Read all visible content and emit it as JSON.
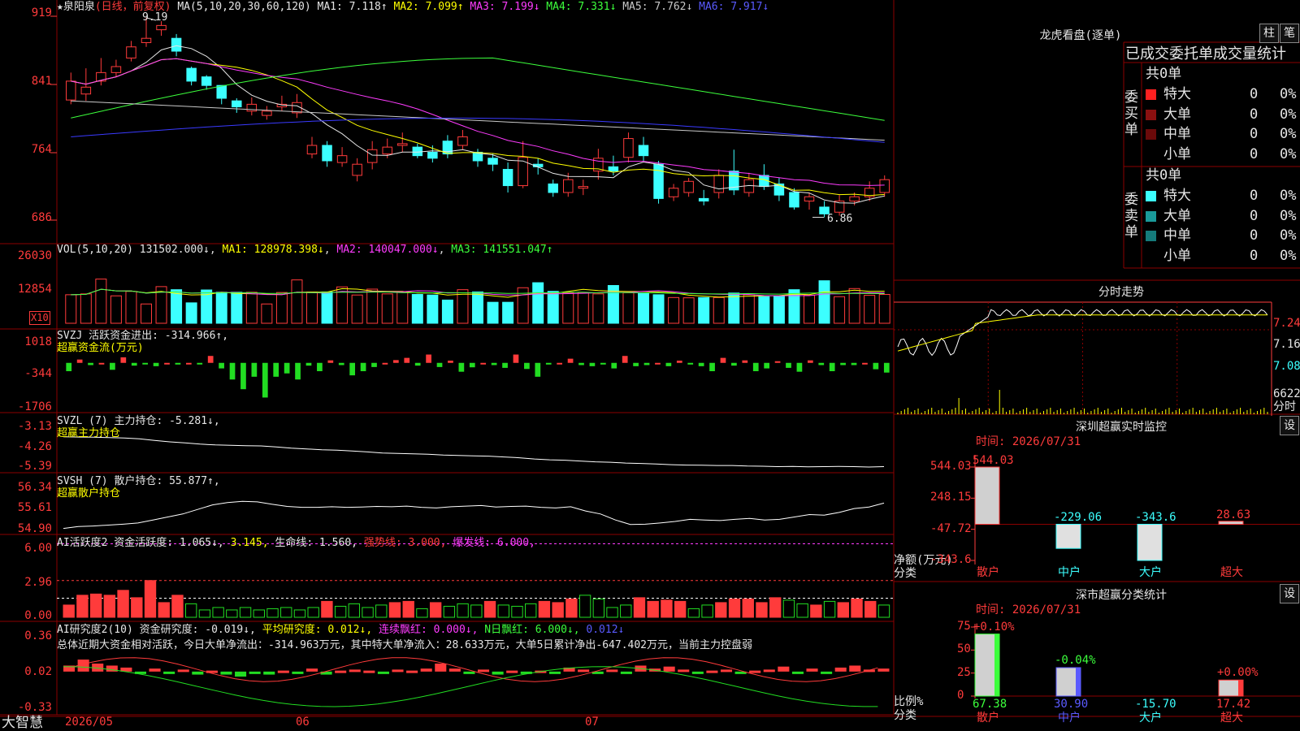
{
  "colors": {
    "up": "#ff3b3b",
    "down": "#3cffff",
    "ma1": "#e6e6e6",
    "ma2": "#ffff00",
    "ma3": "#ff3cff",
    "ma4": "#3cff3c",
    "ma5": "#c8c8c8",
    "ma6": "#3a3aff",
    "grid": "#8b0000"
  },
  "header": {
    "stock_name": "泉阳泉",
    "period": "(日线，前复权)",
    "ma_params": "MA(5,10,20,30,60,120)",
    "ma1": "MA1: 7.118↑",
    "ma2": "MA2: 7.099↑",
    "ma3": "MA3: 7.199↓",
    "ma4": "MA4: 7.331↓",
    "ma5": "MA5: 7.762↓",
    "ma6": "MA6: 7.917↓",
    "high_marker": "9.19",
    "low_marker": "6.86"
  },
  "price_axis": [
    "919",
    "841",
    "764",
    "686"
  ],
  "volume": {
    "label": "VOL(5,10,20)",
    "value": "131502.000↓",
    "ma1": "MA1: 128978.398↓",
    "ma2": "MA2: 140047.000↓",
    "ma3": "MA3: 141551.047↑",
    "axis": [
      "26030",
      "12854"
    ],
    "unit": "X10"
  },
  "svzj": {
    "line1": "SVZJ  活跃资金进出: -314.966↑,",
    "line2": "超赢资金流(万元)",
    "axis": [
      "1018",
      "-344",
      "-1706"
    ]
  },
  "svzl": {
    "line1": "SVZL (7) 主力持仓: -5.281↓,",
    "line2": "超赢主力持仓",
    "axis": [
      "-3.13",
      "-4.26",
      "-5.39"
    ]
  },
  "svsh": {
    "line1": "SVSH (7) 散户持仓: 55.877↑,",
    "line2": "超赢散户持仓",
    "axis": [
      "56.34",
      "55.61",
      "54.90"
    ]
  },
  "ai_active": {
    "label": "AI活跃度2 资金活跃度: 1.065↓,",
    "v2": "3.145,",
    "life": "生命线: 1.560,",
    "strong": "强势线: 3.000,",
    "burst": "爆发线: 6.000,",
    "axis": [
      "6.00",
      "2.96",
      "0.00"
    ]
  },
  "ai_research": {
    "label": "AI研究度2(10) 资金研究度: -0.019↓,",
    "avg": "平均研究度: 0.012↓,",
    "lianxu": "连续飘红: 0.000↓,",
    "nday": "N日飘红: 6.000↓,",
    "last": "0.012↓",
    "summary": "总体近期大资金相对活跃，今日大单净流出：-314.963万元，其中特大单净流入：28.633万元，大单5日累计净出-647.402万元，当前主力控盘弱",
    "axis": [
      "0.36",
      "0.02",
      "-0.33"
    ]
  },
  "bottom": {
    "brand": "大智慧",
    "dates": [
      "2026/05",
      "06",
      "07"
    ]
  },
  "longhu": {
    "title": "龙虎看盘(逐单)",
    "btn1": "柱",
    "btn2": "笔",
    "subtitle": "已成交委托单成交量统计",
    "buy": {
      "side": "委买单",
      "total": "共0单",
      "rows": [
        {
          "name": "特大",
          "v": "0",
          "p": "0%",
          "color": "#ff2020"
        },
        {
          "name": "大单",
          "v": "0",
          "p": "0%",
          "color": "#8b1010"
        },
        {
          "name": "中单",
          "v": "0",
          "p": "0%",
          "color": "#6b0a0a"
        },
        {
          "name": "小单",
          "v": "0",
          "p": "0%",
          "color": "#000000"
        }
      ]
    },
    "sell": {
      "side": "委卖单",
      "total": "共0单",
      "rows": [
        {
          "name": "特大",
          "v": "0",
          "p": "0%",
          "color": "#3cffff"
        },
        {
          "name": "大单",
          "v": "0",
          "p": "0%",
          "color": "#1a9a9a"
        },
        {
          "name": "中单",
          "v": "0",
          "p": "0%",
          "color": "#157a7a"
        },
        {
          "name": "小单",
          "v": "0",
          "p": "0%",
          "color": "#000000"
        }
      ]
    }
  },
  "intraday": {
    "title": "分时走势",
    "axis": [
      "7.24",
      "7.16",
      "7.08"
    ],
    "vol_max": "6622",
    "vol_unit": "分时"
  },
  "monitor": {
    "title": "深圳超赢实时监控",
    "btn": "设",
    "time": "时间: 2026/07/31",
    "axis": [
      "544.03",
      "248.15",
      "-47.72",
      "-343.6"
    ],
    "unit": "净额(万元)",
    "cat_label": "分类",
    "bars": [
      {
        "cat": "散户",
        "value": 544.03,
        "label": "544.03"
      },
      {
        "cat": "中户",
        "value": -229.06,
        "label": "-229.06"
      },
      {
        "cat": "大户",
        "value": -343.6,
        "label": "-343.6"
      },
      {
        "cat": "超大",
        "value": 28.63,
        "label": "28.63"
      }
    ]
  },
  "classify": {
    "title": "深市超赢分类统计",
    "btn": "设",
    "time": "时间: 2026/07/31",
    "axis": [
      "75",
      "50",
      "25",
      "0"
    ],
    "unit": "比例%",
    "cat_label": "分类",
    "bars": [
      {
        "cat": "散户",
        "value": 67.38,
        "top": "+0.10%",
        "bottom": "67.38"
      },
      {
        "cat": "中户",
        "value": 30.9,
        "top": "-0.04%",
        "bottom": "30.90"
      },
      {
        "cat": "大户",
        "value": -15.7,
        "top": "",
        "bottom": "-15.70"
      },
      {
        "cat": "超大",
        "value": 17.42,
        "top": "+0.00%",
        "bottom": "17.42"
      }
    ]
  },
  "chart_data": {
    "type": "candlestick",
    "price": {
      "ylim": [
        6.6,
        9.35
      ],
      "open": [
        8.23,
        8.3,
        8.45,
        8.55,
        8.72,
        8.9,
        9.05,
        8.95,
        8.6,
        8.5,
        8.4,
        8.22,
        8.1,
        8.05,
        8.15,
        8.08,
        7.6,
        7.7,
        7.5,
        7.35,
        7.5,
        7.6,
        7.7,
        7.68,
        7.62,
        7.75,
        7.7,
        7.62,
        7.55,
        7.42,
        7.23,
        7.48,
        7.25,
        7.15,
        7.2,
        7.4,
        7.45,
        7.56,
        7.7,
        7.48,
        7.1,
        7.15,
        7.08,
        7.15,
        7.4,
        7.15,
        7.35,
        7.25,
        7.15,
        7.05,
        6.98,
        6.92,
        7.05,
        7.1,
        7.15
      ],
      "close": [
        8.45,
        8.38,
        8.55,
        8.62,
        8.85,
        8.95,
        9.1,
        8.8,
        8.45,
        8.4,
        8.25,
        8.15,
        8.18,
        8.1,
        8.18,
        8.2,
        7.7,
        7.52,
        7.58,
        7.48,
        7.65,
        7.68,
        7.72,
        7.58,
        7.55,
        7.6,
        7.8,
        7.52,
        7.48,
        7.23,
        7.56,
        7.45,
        7.15,
        7.3,
        7.22,
        7.55,
        7.4,
        7.78,
        7.58,
        7.08,
        7.2,
        7.28,
        7.05,
        7.35,
        7.18,
        7.3,
        7.22,
        7.12,
        6.98,
        7.1,
        6.9,
        7.05,
        7.1,
        7.2,
        7.3
      ],
      "high": [
        8.55,
        8.6,
        8.72,
        8.7,
        8.92,
        9.19,
        9.15,
        9.0,
        8.62,
        8.52,
        8.4,
        8.25,
        8.26,
        8.16,
        8.28,
        8.3,
        7.8,
        7.75,
        7.68,
        7.55,
        7.75,
        7.78,
        7.85,
        7.72,
        7.7,
        7.82,
        7.88,
        7.66,
        7.6,
        7.5,
        7.75,
        7.55,
        7.3,
        7.38,
        7.3,
        7.66,
        7.58,
        7.85,
        7.8,
        7.52,
        7.25,
        7.32,
        7.18,
        7.42,
        7.65,
        7.38,
        7.48,
        7.32,
        7.2,
        7.15,
        7.05,
        7.12,
        7.15,
        7.28,
        7.35
      ],
      "low": [
        8.18,
        8.22,
        8.4,
        8.5,
        8.68,
        8.85,
        8.98,
        8.74,
        8.4,
        8.35,
        8.18,
        8.08,
        8.05,
        8.0,
        8.1,
        8.02,
        7.55,
        7.45,
        7.45,
        7.28,
        7.42,
        7.55,
        7.62,
        7.55,
        7.5,
        7.55,
        7.65,
        7.45,
        7.4,
        7.15,
        7.2,
        7.36,
        7.1,
        7.1,
        7.12,
        7.3,
        7.35,
        7.5,
        7.52,
        7.02,
        7.05,
        7.1,
        7.0,
        7.08,
        7.12,
        7.1,
        7.18,
        7.05,
        6.95,
        6.95,
        6.86,
        6.88,
        7.0,
        7.05,
        7.1
      ]
    },
    "volume": {
      "ylim": [
        0,
        27000
      ],
      "values": [
        10200,
        10500,
        15800,
        9800,
        11400,
        6900,
        13100,
        12000,
        7300,
        11900,
        11100,
        11100,
        11100,
        6900,
        11000,
        15500,
        11200,
        11200,
        13000,
        10100,
        12200,
        10500,
        11100,
        10300,
        10100,
        8300,
        12000,
        11200,
        7500,
        7500,
        12700,
        14500,
        11400,
        10900,
        11000,
        10500,
        13500,
        10900,
        10800,
        10200,
        9200,
        9100,
        9200,
        9200,
        10800,
        10200,
        9500,
        9600,
        12000,
        10000,
        15200,
        9500,
        12400,
        10000,
        10300,
        10000
      ]
    },
    "fund_flow": {
      "values": [
        -300,
        120,
        -80,
        0,
        -250,
        200,
        -100,
        -30,
        -120,
        0,
        -60,
        0,
        -50,
        250,
        -200,
        -600,
        -950,
        -500,
        -1250,
        -500,
        -380,
        -600,
        -100,
        -300,
        90,
        -80,
        -450,
        -300,
        -150,
        0,
        100,
        180,
        -100,
        300,
        -150,
        80,
        -320,
        -160,
        0,
        -80,
        -180,
        300,
        -220,
        -500,
        -60,
        0,
        150,
        -80,
        -120,
        -60,
        -200,
        250,
        -120,
        -80,
        0,
        -120,
        80,
        -60,
        -120,
        -300,
        180,
        -100,
        90,
        -300,
        -200,
        60,
        -180,
        -320,
        90,
        -80,
        -300,
        -80,
        -80,
        0,
        -230,
        -350
      ]
    },
    "main_hold": {
      "ylim": [
        -5.5,
        -3.0
      ],
      "values": [
        -3.8,
        -3.81,
        -3.82,
        -3.84,
        -3.86,
        -3.9,
        -3.98,
        -4.05,
        -4.1,
        -4.16,
        -4.2,
        -4.22,
        -4.24,
        -4.25,
        -4.3,
        -4.36,
        -4.4,
        -4.44,
        -4.46,
        -4.5,
        -4.55,
        -4.6,
        -4.62,
        -4.64,
        -4.66,
        -4.7,
        -4.72,
        -4.74,
        -4.76,
        -4.8,
        -4.84,
        -4.9,
        -4.94,
        -4.96,
        -5.0,
        -5.04,
        -5.06,
        -5.1,
        -5.12,
        -5.15,
        -5.18,
        -5.2,
        -5.21,
        -5.22,
        -5.22,
        -5.25,
        -5.26,
        -5.28,
        -5.27,
        -5.29,
        -5.28,
        -5.27,
        -5.28,
        -5.3,
        -5.28
      ]
    },
    "retail_hold": {
      "ylim": [
        54.8,
        56.5
      ],
      "values": [
        54.92,
        54.98,
        55.0,
        55.03,
        55.06,
        55.1,
        55.2,
        55.3,
        55.4,
        55.55,
        55.7,
        55.78,
        55.82,
        55.8,
        55.72,
        55.65,
        55.62,
        55.62,
        55.64,
        55.62,
        55.63,
        55.65,
        55.64,
        55.66,
        55.62,
        55.6,
        55.64,
        55.66,
        55.68,
        55.63,
        55.65,
        55.66,
        55.62,
        55.6,
        55.64,
        55.5,
        55.4,
        55.2,
        55.05,
        55.06,
        55.1,
        55.15,
        55.22,
        55.2,
        55.18,
        55.22,
        55.25,
        55.2,
        55.22,
        55.3,
        55.38,
        55.36,
        55.45,
        55.58,
        55.63,
        55.76
      ]
    },
    "ai_active": {
      "ylim": [
        0,
        6.5
      ],
      "values": [
        1.0,
        1.8,
        1.9,
        1.8,
        2.2,
        1.6,
        3.0,
        1.2,
        1.8,
        1.1,
        0.6,
        0.8,
        0.6,
        0.8,
        0.6,
        0.7,
        0.8,
        0.6,
        0.8,
        1.3,
        0.9,
        1.1,
        0.8,
        1.0,
        1.2,
        1.3,
        0.7,
        1.2,
        0.9,
        1.1,
        1.0,
        1.3,
        1.0,
        0.9,
        1.1,
        1.3,
        1.2,
        1.5,
        1.8,
        1.5,
        0.8,
        1.0,
        1.6,
        1.3,
        1.4,
        1.3,
        0.7,
        1.0,
        1.2,
        1.5,
        1.5,
        1.2,
        1.6,
        1.4,
        1.1,
        1.0,
        1.3,
        1.2,
        1.5,
        1.3,
        1.0
      ],
      "up": [
        1,
        1,
        1,
        1,
        1,
        1,
        1,
        1,
        1,
        0,
        0,
        0,
        0,
        0,
        0,
        0,
        0,
        0,
        0,
        1,
        0,
        0,
        0,
        0,
        1,
        1,
        0,
        1,
        0,
        0,
        0,
        1,
        0,
        0,
        0,
        1,
        1,
        1,
        0,
        0,
        0,
        0,
        1,
        1,
        1,
        1,
        0,
        0,
        1,
        1,
        1,
        1,
        1,
        0,
        0,
        1,
        0,
        1,
        1,
        1,
        0
      ]
    },
    "ai_research": {
      "ylim": [
        -0.35,
        0.38
      ],
      "values": [
        0.06,
        0.12,
        0.08,
        0.06,
        0.04,
        -0.02,
        0.03,
        -0.02,
        0.02,
        -0.03,
        0.01,
        -0.03,
        -0.05,
        -0.02,
        -0.03,
        0.01,
        -0.02,
        0.03,
        -0.03,
        0.01,
        0.02,
        0.01,
        -0.01,
        0.02,
        0.01,
        0.03,
        0.08,
        0.03,
        -0.01,
        0.02,
        -0.03,
        0.01,
        -0.01,
        0.01,
        -0.02,
        0.04,
        0.02,
        -0.01,
        0.02,
        -0.02,
        0.06,
        0.03,
        0.05,
        0.02,
        -0.01,
        0.01,
        0.02,
        -0.02,
        0.01,
        0.02,
        0.05,
        -0.01,
        0.03,
        -0.02,
        0.04,
        0.06,
        0.02,
        0.03
      ]
    }
  }
}
